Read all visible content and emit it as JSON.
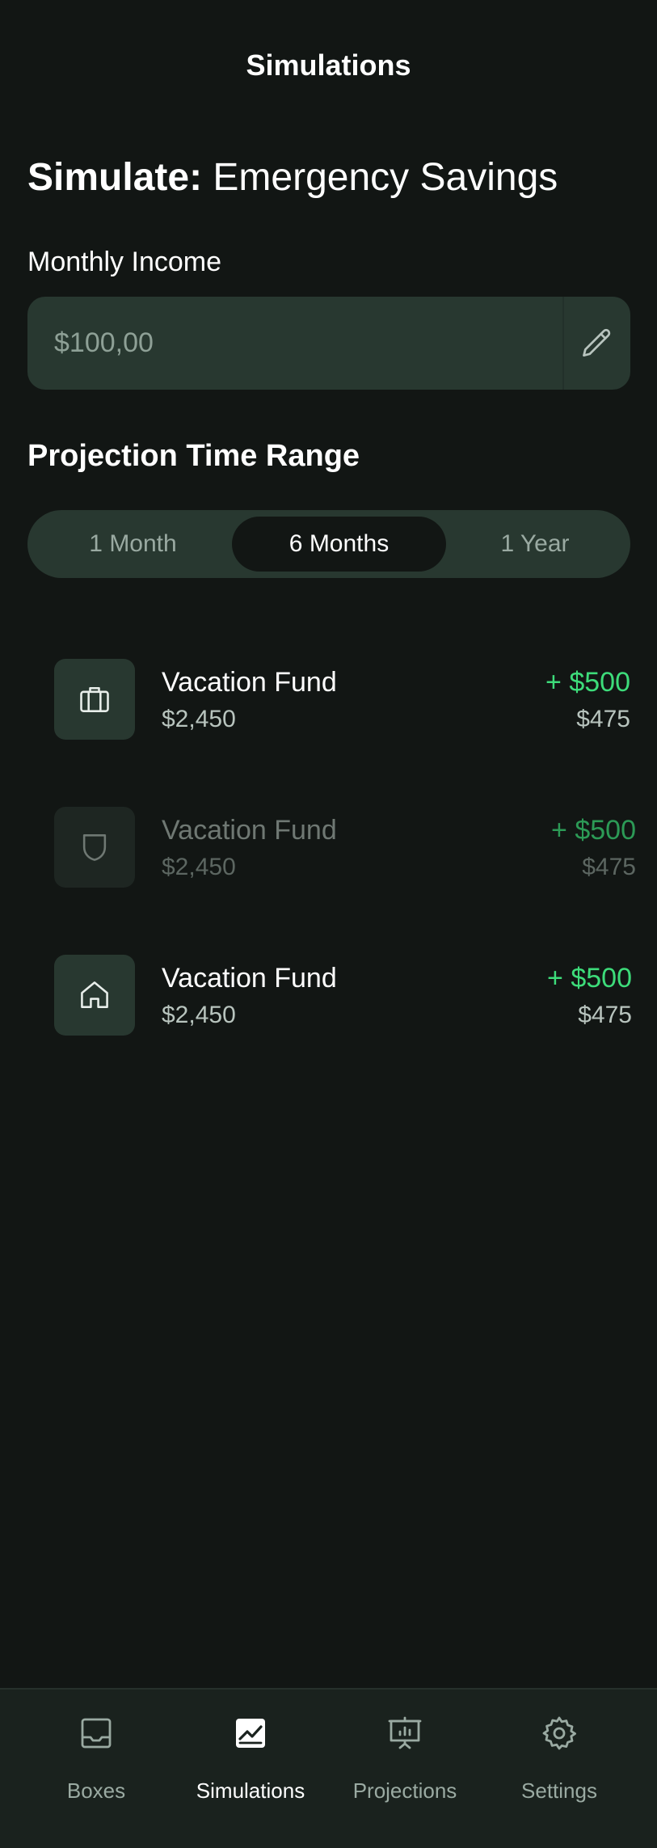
{
  "header": {
    "title": "Simulations"
  },
  "simulation": {
    "label": "Simulate:",
    "name": "Emergency Savings"
  },
  "income": {
    "label": "Monthly Income",
    "placeholder": "$100,00"
  },
  "projection": {
    "heading": "Projection Time Range",
    "options": [
      {
        "label": "1 Month",
        "selected": false
      },
      {
        "label": "6 Months",
        "selected": true
      },
      {
        "label": "1 Year",
        "selected": false
      }
    ]
  },
  "boxes": [
    {
      "icon": "briefcase-icon",
      "title": "Vacation Fund",
      "balance": "$2,450",
      "delta": "+ $500",
      "amount": "$475",
      "dimmed": false
    },
    {
      "icon": "shield-icon",
      "title": "Vacation Fund",
      "balance": "$2,450",
      "delta": "+ $500",
      "amount": "$475",
      "dimmed": true
    },
    {
      "icon": "home-icon",
      "title": "Vacation Fund",
      "balance": "$2,450",
      "delta": "+ $500",
      "amount": "$475",
      "dimmed": false
    }
  ],
  "tabs": [
    {
      "label": "Boxes",
      "icon": "inbox-icon",
      "active": false
    },
    {
      "label": "Simulations",
      "icon": "chart-icon",
      "active": true
    },
    {
      "label": "Projections",
      "icon": "presentation-icon",
      "active": false
    },
    {
      "label": "Settings",
      "icon": "gear-icon",
      "active": false
    }
  ],
  "colors": {
    "background": "#121614",
    "surface": "#283830",
    "accent_green": "#3ddc7a",
    "tabbar": "#1a221e"
  }
}
